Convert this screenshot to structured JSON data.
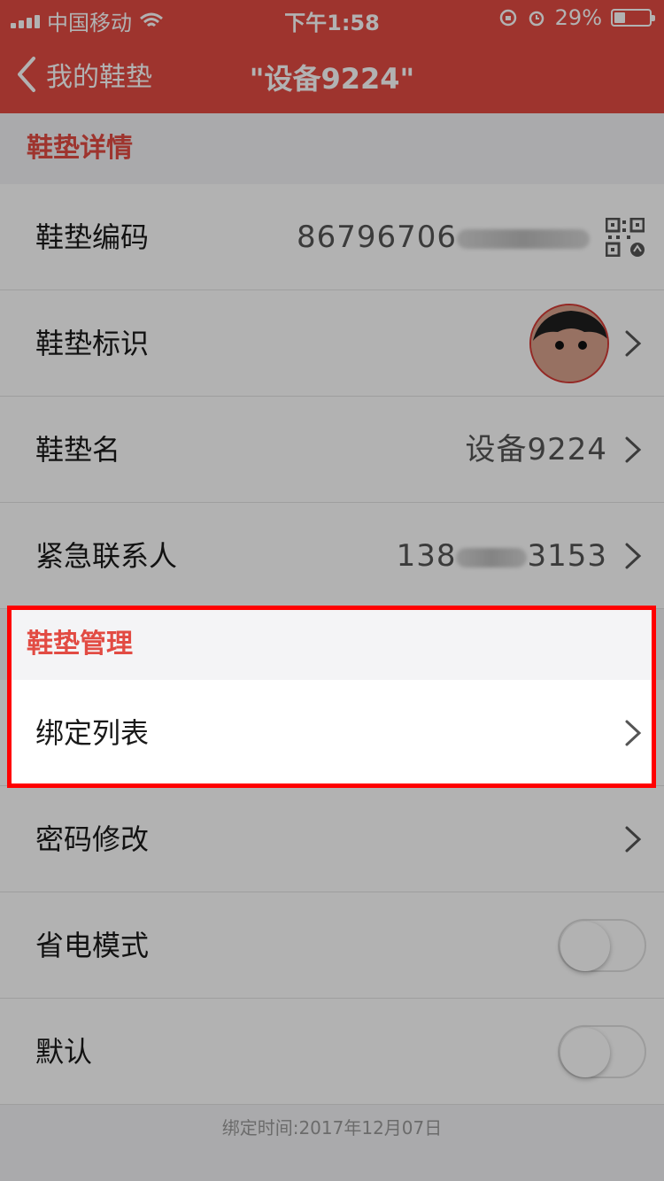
{
  "status_bar": {
    "carrier": "中国移动",
    "time": "下午1:58",
    "battery": "29%",
    "battery_level_percent": 29
  },
  "nav": {
    "back_label": "我的鞋垫",
    "title": "\"设备9224\""
  },
  "sections": {
    "details_header": "鞋垫详情",
    "management_header": "鞋垫管理"
  },
  "rows": {
    "code": {
      "label": "鞋垫编码",
      "value": "86796706"
    },
    "identity": {
      "label": "鞋垫标识"
    },
    "name": {
      "label": "鞋垫名",
      "value": "设备9224"
    },
    "emergency": {
      "label": "紧急联系人",
      "value_prefix": "138",
      "value_suffix": "3153"
    },
    "binding_list": {
      "label": "绑定列表"
    },
    "password": {
      "label": "密码修改"
    },
    "power_save": {
      "label": "省电模式",
      "enabled": false
    },
    "default": {
      "label": "默认",
      "enabled": false
    }
  },
  "footer": {
    "bind_time": "绑定时间:2017年12月07日"
  },
  "colors": {
    "accent": "#e24b43",
    "highlight": "#ff0000"
  }
}
